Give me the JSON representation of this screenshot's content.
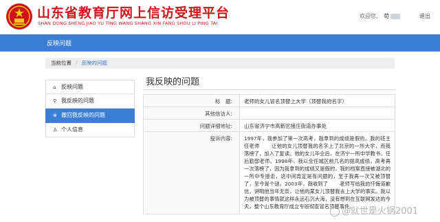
{
  "header": {
    "title": "山东省教育厅网上信访受理平台",
    "pinyin": "SHAN DONG SHENG JIAO YU TING WANG SHANG XIN FANG SHOU LI PING TAI",
    "welcome_label": "欢迎您,",
    "user_name": "苟",
    "logout_label": "退出"
  },
  "nav": {
    "item": "反映问题"
  },
  "breadcrumb": {
    "label": "当前位置",
    "current": "反映的问题"
  },
  "sidebar": {
    "items": [
      {
        "icon": "home-icon",
        "label": "反映问题"
      },
      {
        "icon": "search-icon",
        "label": "我反映的问题"
      },
      {
        "icon": "circle-x-icon",
        "label": "撤回我反映的问题"
      },
      {
        "icon": "user-icon",
        "label": "个人信息"
      }
    ]
  },
  "main": {
    "title": "我反映的问题",
    "fields": {
      "subject_label": "标　题:",
      "subject_value": "老师的女儿冒名顶替上大学（顶替我的名字）",
      "visitor_label": "其他信访人:",
      "visitor_value": "",
      "location_label": "问题详细地址:",
      "location_value": "山东省济宁市高新区接庄街道办事处",
      "content_label": "投诉内容:",
      "content_value": "1997年，我参加了第一次高考，我拿到的成绩是假的，我的班主任老师 　　让他的女儿顶替我的名字上了北京的一所大学，而我落榜了，加入了复读。他的女儿毕业后，在济宁一所中学教书，任后勤部老师。1998年，我以全任城区前几名的提高成绩，高考再一次落榜了，因为我拿到的成绩又是假的，我的档案直接被湖北的一所中专接走，这中间肯定是有问题的，至于我再一次又被顶替了，至今是个谜。2003年，我收到了 　　老师写给我的忏悔道歉信，讲明他当年无奈，让他的某女儿顶替我去上大学的事实。我以为被顶替的事情就这样永远石沉大海，没有想到在互联网发达的今天，整个山东教育厅成立专班彻查冒名顶替事件。"
    }
  },
  "watermark": {
    "text": "@就世是火锅2001"
  }
}
